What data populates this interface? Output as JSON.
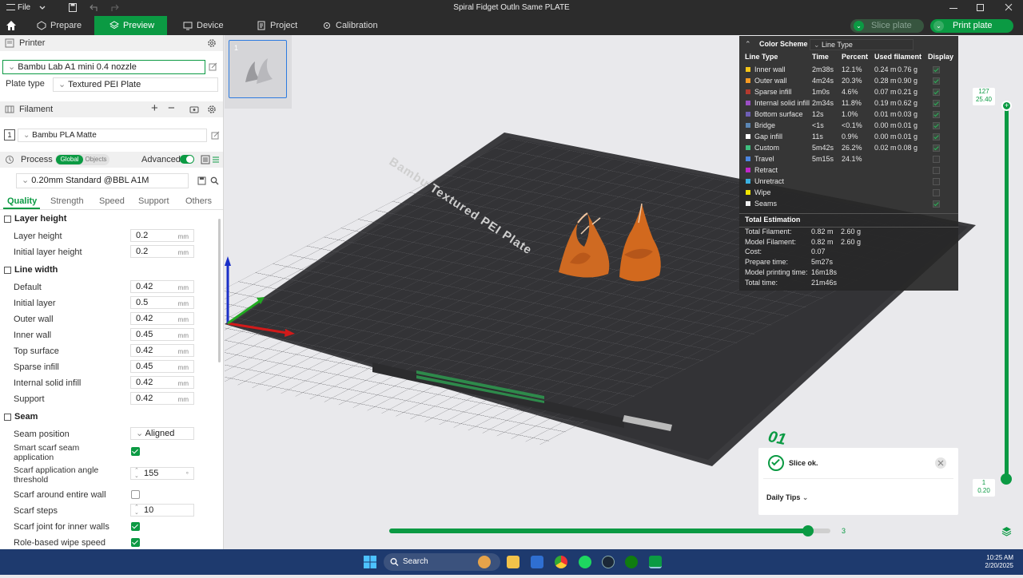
{
  "titlebar": {
    "file_label": "File",
    "title": "Spiral Fidget Outln Same PLATE"
  },
  "menubar": {
    "tabs": [
      {
        "label": "Prepare"
      },
      {
        "label": "Preview"
      },
      {
        "label": "Device"
      },
      {
        "label": "Project"
      },
      {
        "label": "Calibration"
      }
    ],
    "slice_label": "Slice plate",
    "print_label": "Print plate"
  },
  "printer": {
    "section_label": "Printer",
    "printer_name": "Bambu Lab A1 mini 0.4 nozzle",
    "plate_type_label": "Plate type",
    "plate_type_value": "Textured PEI Plate"
  },
  "filament": {
    "section_label": "Filament",
    "slot": "1",
    "name": "Bambu PLA Matte"
  },
  "process": {
    "section_label": "Process",
    "toggle_global": "Global",
    "toggle_objects": "Objects",
    "advanced_label": "Advanced",
    "preset": "0.20mm Standard @BBL A1M",
    "tabs": [
      "Quality",
      "Strength",
      "Speed",
      "Support",
      "Others"
    ]
  },
  "settings": {
    "layer_height_group": "Layer height",
    "layer_height_label": "Layer height",
    "layer_height_value": "0.2",
    "initial_layer_height_label": "Initial layer height",
    "initial_layer_height_value": "0.2",
    "line_width_group": "Line width",
    "default_label": "Default",
    "default_value": "0.42",
    "initial_layer_label": "Initial layer",
    "initial_layer_value": "0.5",
    "outer_wall_label": "Outer wall",
    "outer_wall_value": "0.42",
    "inner_wall_label": "Inner wall",
    "inner_wall_value": "0.45",
    "top_surface_label": "Top surface",
    "top_surface_value": "0.42",
    "sparse_infill_label": "Sparse infill",
    "sparse_infill_value": "0.45",
    "internal_solid_label": "Internal solid infill",
    "internal_solid_value": "0.42",
    "support_label": "Support",
    "support_value": "0.42",
    "unit": "mm",
    "seam_group": "Seam",
    "seam_position_label": "Seam position",
    "seam_position_value": "Aligned",
    "smart_scarf_label_1": "Smart scarf seam",
    "smart_scarf_label_2": "application",
    "scarf_angle_label_1": "Scarf application angle",
    "scarf_angle_label_2": "threshold",
    "scarf_angle_value": "155",
    "scarf_around_label": "Scarf around entire wall",
    "scarf_steps_label": "Scarf steps",
    "scarf_steps_value": "10",
    "scarf_inner_label": "Scarf joint for inner walls",
    "role_wipe_label": "Role-based wipe speed"
  },
  "plate_thumb": {
    "number": "1"
  },
  "bed": {
    "label": "Bambu Textured PEI Plate",
    "corner_mark": "01"
  },
  "legend": {
    "title": "Color Scheme",
    "scheme_value": "Line Type",
    "headers": [
      "Line Type",
      "Time",
      "Percent",
      "Used filament",
      "Display"
    ],
    "rows": [
      {
        "name": "Inner wall",
        "time": "2m38s",
        "percent": "12.1%",
        "len": "0.24 m",
        "wt": "0.76 g",
        "color": "#f5c518",
        "display": true
      },
      {
        "name": "Outer wall",
        "time": "4m24s",
        "percent": "20.3%",
        "len": "0.28 m",
        "wt": "0.90 g",
        "color": "#f59a23",
        "display": true
      },
      {
        "name": "Sparse infill",
        "time": "1m0s",
        "percent": "4.6%",
        "len": "0.07 m",
        "wt": "0.21 g",
        "color": "#b23a2e",
        "display": true
      },
      {
        "name": "Internal solid infill",
        "time": "2m34s",
        "percent": "11.8%",
        "len": "0.19 m",
        "wt": "0.62 g",
        "color": "#9b4fc4",
        "display": true
      },
      {
        "name": "Bottom surface",
        "time": "12s",
        "percent": "1.0%",
        "len": "0.01 m",
        "wt": "0.03 g",
        "color": "#6e5fb5",
        "display": true
      },
      {
        "name": "Bridge",
        "time": "<1s",
        "percent": "<0.1%",
        "len": "0.00 m",
        "wt": "0.01 g",
        "color": "#5b86b4",
        "display": true
      },
      {
        "name": "Gap infill",
        "time": "11s",
        "percent": "0.9%",
        "len": "0.00 m",
        "wt": "0.01 g",
        "color": "#ffffff",
        "display": true
      },
      {
        "name": "Custom",
        "time": "5m42s",
        "percent": "26.2%",
        "len": "0.02 m",
        "wt": "0.08 g",
        "color": "#3fbf7f",
        "display": true
      },
      {
        "name": "Travel",
        "time": "5m15s",
        "percent": "24.1%",
        "len": "",
        "wt": "",
        "color": "#4c86e0",
        "display": false
      },
      {
        "name": "Retract",
        "time": "",
        "percent": "",
        "len": "",
        "wt": "",
        "color": "#c127c9",
        "display": false
      },
      {
        "name": "Unretract",
        "time": "",
        "percent": "",
        "len": "",
        "wt": "",
        "color": "#3ab0e0",
        "display": false
      },
      {
        "name": "Wipe",
        "time": "",
        "percent": "",
        "len": "",
        "wt": "",
        "color": "#f2e600",
        "display": false
      },
      {
        "name": "Seams",
        "time": "",
        "percent": "",
        "len": "",
        "wt": "",
        "color": "#f0f0f0",
        "display": true
      }
    ],
    "estimation_title": "Total Estimation",
    "est": [
      {
        "label": "Total Filament:",
        "v1": "0.82 m",
        "v2": "2.60 g"
      },
      {
        "label": "Model Filament:",
        "v1": "0.82 m",
        "v2": "2.60 g"
      },
      {
        "label": "Cost:",
        "v1": "0.07",
        "v2": ""
      },
      {
        "label": "Prepare time:",
        "v1": "5m27s",
        "v2": ""
      },
      {
        "label": "Model printing time:",
        "v1": "16m18s",
        "v2": ""
      },
      {
        "label": "Total time:",
        "v1": "21m46s",
        "v2": ""
      }
    ]
  },
  "layer_slider": {
    "top_layer": "127",
    "top_height": "25.40",
    "bottom_layer": "1",
    "bottom_height": "0.20"
  },
  "move_slider": {
    "value": "3",
    "fill_fraction": 0.95
  },
  "toast": {
    "message": "Slice ok.",
    "tips_label": "Daily Tips"
  },
  "taskbar": {
    "search_label": "Search",
    "time": "10:25 AM",
    "date": "2/20/2025"
  },
  "colors": {
    "accent": "#0b9a43",
    "model": "#d2691e"
  }
}
